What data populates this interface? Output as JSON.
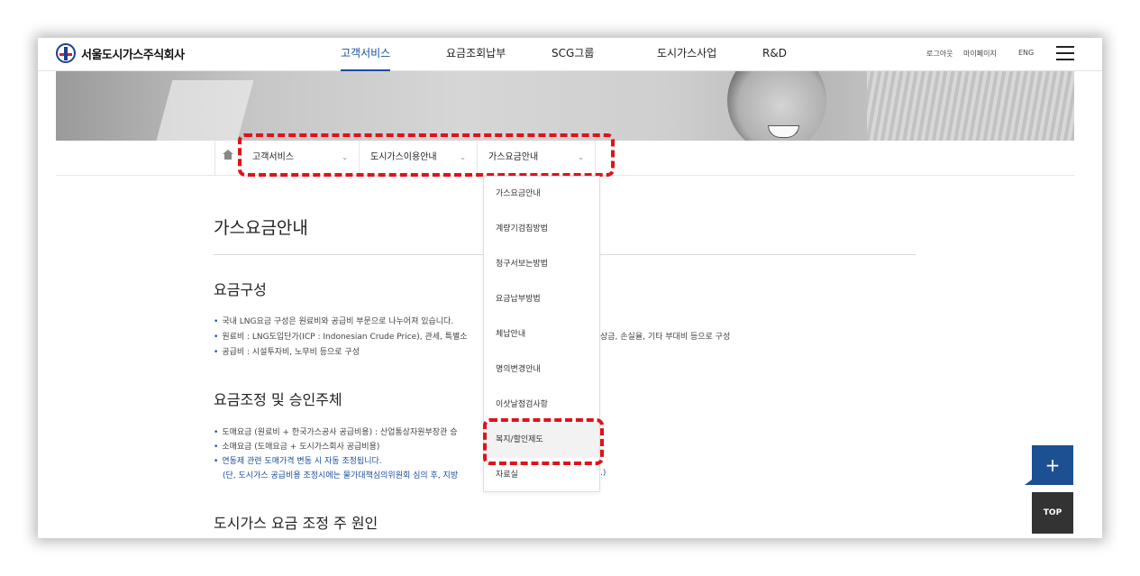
{
  "header": {
    "logo_text": "서울도시가스주식회사",
    "nav": [
      "고객서비스",
      "요금조회납부",
      "SCG그룹",
      "도시가스사업",
      "R&D"
    ],
    "util": [
      "로그아웃",
      "마이페이지",
      "ENG"
    ]
  },
  "breadcrumb": {
    "items": [
      "고객서비스",
      "도시가스이용안내",
      "가스요금안내"
    ],
    "chevron": "⌄"
  },
  "dropdown": {
    "items": [
      "가스요금안내",
      "계량기검침방법",
      "청구서보는방법",
      "요금납부방법",
      "체납안내",
      "명의변경안내",
      "이삿날점검사항",
      "복지/할인제도",
      "자료실"
    ]
  },
  "content": {
    "page_title": "가스요금안내",
    "section1": {
      "title": "요금구성",
      "bullets": [
        "국내 LNG요금 구성은 원료비와 공급비 부문으로 나누어져 있습니다.",
        "원료비 : LNG도입단가(ICP : Indonesian Crude Price), 관세, 특별소",
        "공급비 : 시설투자비, 노무비 등으로 구성"
      ],
      "bullet2_tail": "상금, 손실율, 기타 부대비 등으로 구성"
    },
    "section2": {
      "title": "요금조정 및 승인주체",
      "bullets": [
        "도매요금 (원료비 + 한국가스공사 공급비용) : 산업통상자원부장관 승",
        "소매요금 (도매요금 + 도시가스회사 공급비용)",
        "연동제 관련 도매가격 변동 시 자동 조정됩니다."
      ],
      "note": "(단, 도시가스 공급비용 조정시에는 물가대책심의위원회 심의 후, 지방",
      "note_tail": ".)"
    },
    "section3": {
      "title": "도시가스 요금 조정 주 원인"
    }
  },
  "floating": {
    "plus": "+",
    "top": "TOP"
  }
}
